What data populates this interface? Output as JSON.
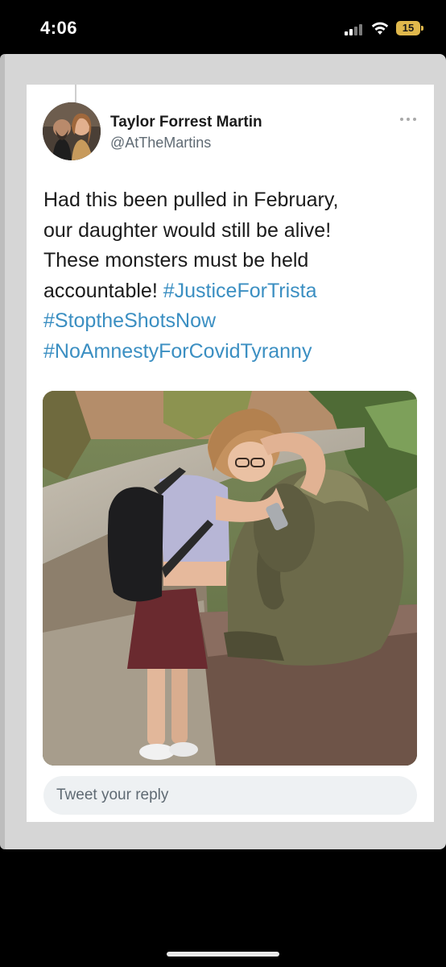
{
  "status_bar": {
    "time": "4:06",
    "battery_level": "15",
    "battery_color": "#e0b84c",
    "icons": [
      "cellular-signal-icon",
      "wifi-icon",
      "battery-icon"
    ]
  },
  "tweet": {
    "display_name": "Taylor Forrest Martin",
    "handle": "@AtTheMartins",
    "text_lines": [
      "Had this been pulled in February,",
      "our daughter would still be alive!",
      "These monsters must be held",
      "accountable!"
    ],
    "hashtags": [
      "#JusticeForTrista",
      "#StoptheShotsNow",
      "#NoAmnestyForCovidTyranny"
    ],
    "hashtag_color": "#3b8fc2",
    "more_icon": "more-horizontal-icon"
  },
  "reply": {
    "placeholder": "Tweet your reply"
  }
}
